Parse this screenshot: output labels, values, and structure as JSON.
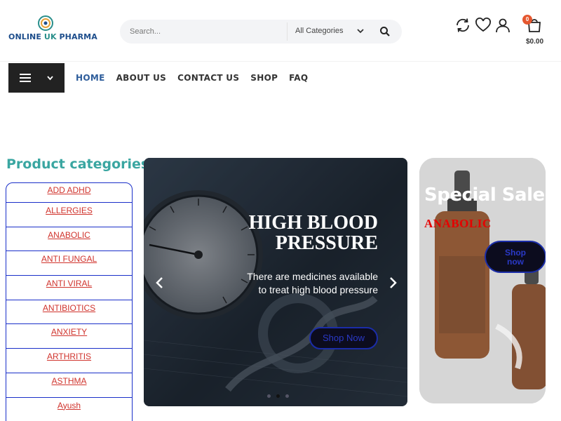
{
  "brand": {
    "name_part1": "ONLINE ",
    "name_part2": "UK",
    "name_part3": " PHARMA"
  },
  "search": {
    "placeholder": "Search...",
    "category": "All Categories"
  },
  "cart": {
    "count": "0",
    "total": "$0.00"
  },
  "nav": {
    "items": [
      "HOME",
      "ABOUT US",
      "CONTACT US",
      "SHOP",
      "FAQ"
    ],
    "active": "HOME"
  },
  "categories": {
    "heading": "Product categories",
    "items": [
      "ADD ADHD",
      "ALLERGIES",
      "ANABOLIC",
      "ANTI FUNGAL",
      "ANTI VIRAL",
      "ANTIBIOTICS",
      "ANXIETY",
      "ARTHRITIS",
      "ASTHMA",
      "Ayush"
    ]
  },
  "slider": {
    "title_line1": "HIGH BLOOD",
    "title_line2": "PRESSURE",
    "text": "There are medicines available to treat high blood pressure",
    "button": "Shop Now"
  },
  "promo": {
    "title": "Special Sale",
    "subtitle": "ANABOLIC",
    "button_line1": "Shop",
    "button_line2": "now"
  },
  "colors": {
    "accent": "#2e5d9b",
    "teal": "#3aa6a1",
    "badge": "#e5572f",
    "link": "#d0332c",
    "border": "#1a2fc9"
  },
  "icons": {
    "refresh": "refresh-icon",
    "wishlist": "heart-icon",
    "account": "user-icon",
    "cart": "cart-icon",
    "search": "search-icon",
    "menu": "hamburger-icon"
  }
}
